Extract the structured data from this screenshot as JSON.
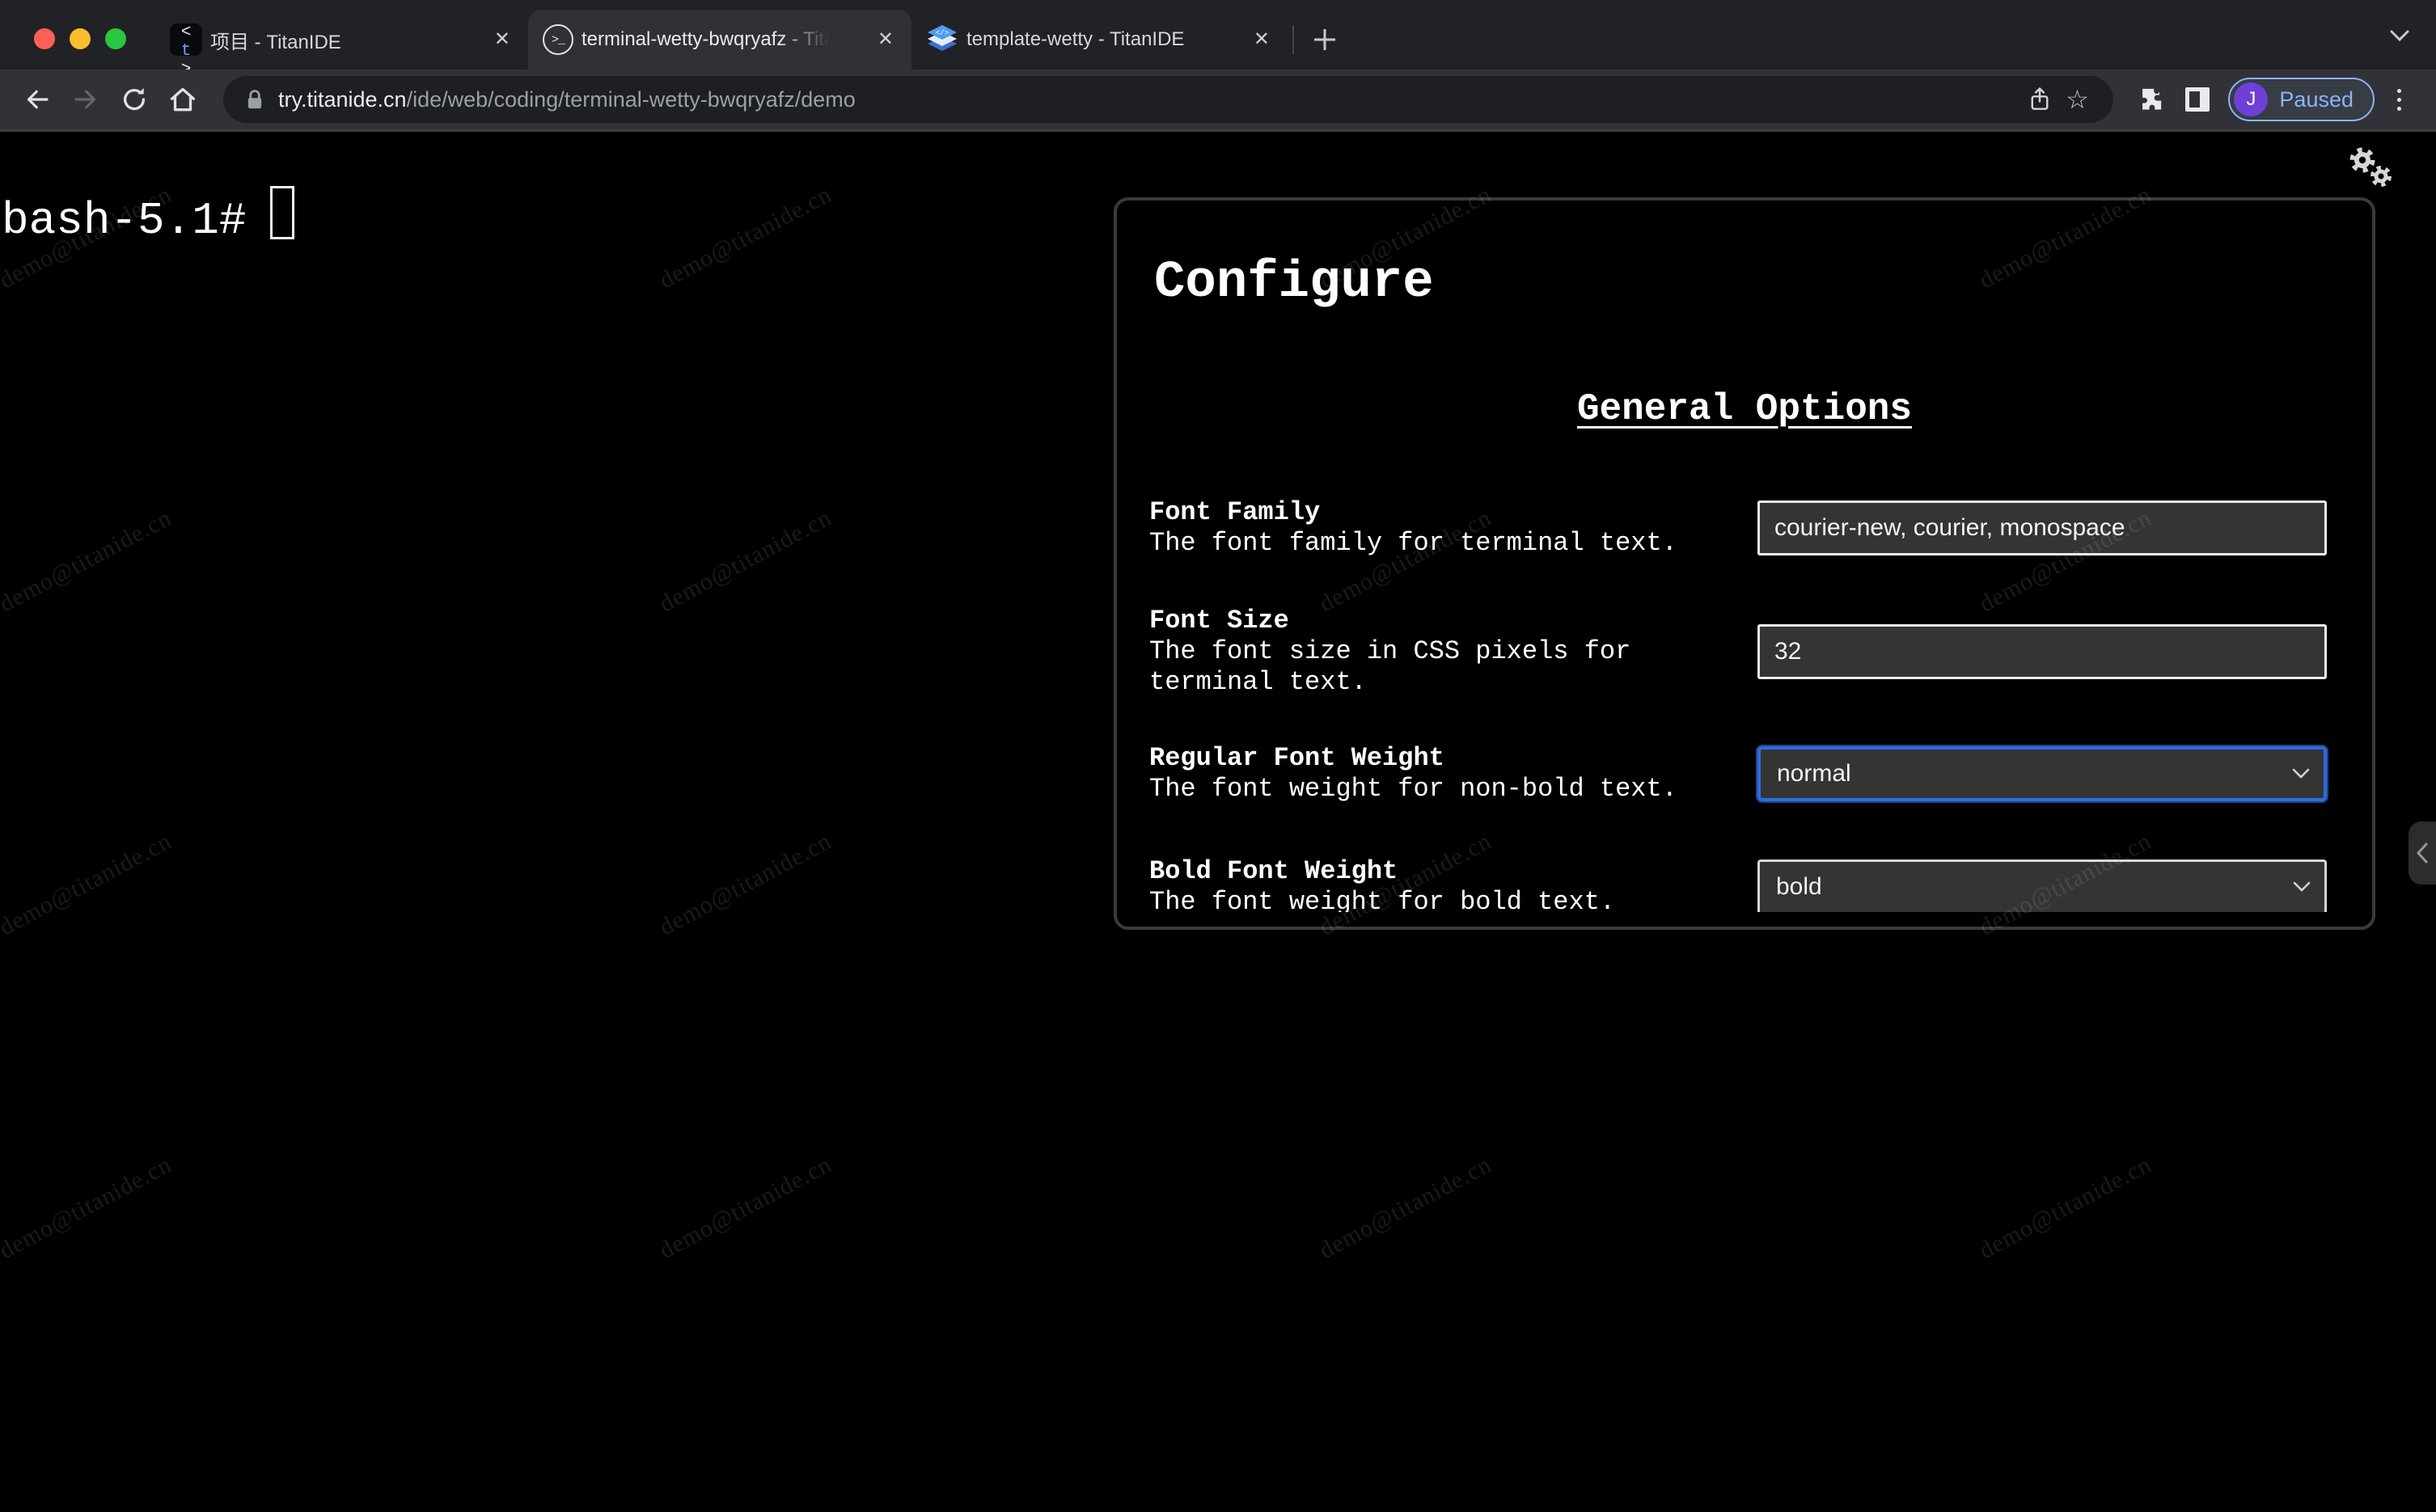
{
  "browser": {
    "window_controls": [
      "close",
      "minimize",
      "zoom"
    ],
    "tabs": [
      {
        "title": "项目 - TitanIDE",
        "icon": "titanide-t-icon",
        "active": false
      },
      {
        "title": "terminal-wetty-bwqryafz - Tita",
        "icon": "terminal-circle-icon",
        "active": true
      },
      {
        "title": "template-wetty - TitanIDE",
        "icon": "blue-layers-icon",
        "active": false
      }
    ],
    "icons": {
      "tab_close": "✕",
      "new_tab": "+",
      "tab_search": "chevron-down",
      "back": "arrow-left",
      "forward": "arrow-right",
      "reload": "circular-arrow",
      "home": "house",
      "lock": "padlock",
      "share": "box-with-up-arrow",
      "bookmark": "☆",
      "extensions": "puzzle-piece",
      "side_panel": "square-right-filled",
      "menu": "⋮"
    },
    "url": {
      "host": "try.titanide.cn",
      "path": "/ide/web/coding/terminal-wetty-bwqryafz/demo"
    },
    "profile": {
      "initial": "J",
      "status": "Paused"
    }
  },
  "terminal": {
    "prompt": "bash-5.1#"
  },
  "page_icons": {
    "settings": "double-gear",
    "collapse_handle": "chevron-left"
  },
  "watermark": {
    "text": "demo@titanide.cn"
  },
  "dialog": {
    "title": "Configure",
    "section_title": "General Options",
    "fields": [
      {
        "label": "Font Family",
        "description": "The font family for terminal text.",
        "control": "input",
        "value": "courier-new, courier, monospace",
        "focused": false
      },
      {
        "label": "Font Size",
        "description": "The font size in CSS pixels for terminal text.",
        "control": "input",
        "value": "32",
        "focused": false
      },
      {
        "label": "Regular Font Weight",
        "description": "The font weight for non-bold text.",
        "control": "select",
        "value": "normal",
        "focused": true
      },
      {
        "label": "Bold Font Weight",
        "description": "The font weight for bold text.",
        "control": "select",
        "value": "bold",
        "focused": false
      }
    ]
  },
  "colors": {
    "accent_blue": "#8ab4f8",
    "focus_blue": "#2e6ae0",
    "profile_purple": "#6e40d8",
    "traffic_red": "#ff5f57",
    "traffic_yellow": "#febc2e",
    "traffic_green": "#28c840",
    "page_background": "#000000"
  }
}
